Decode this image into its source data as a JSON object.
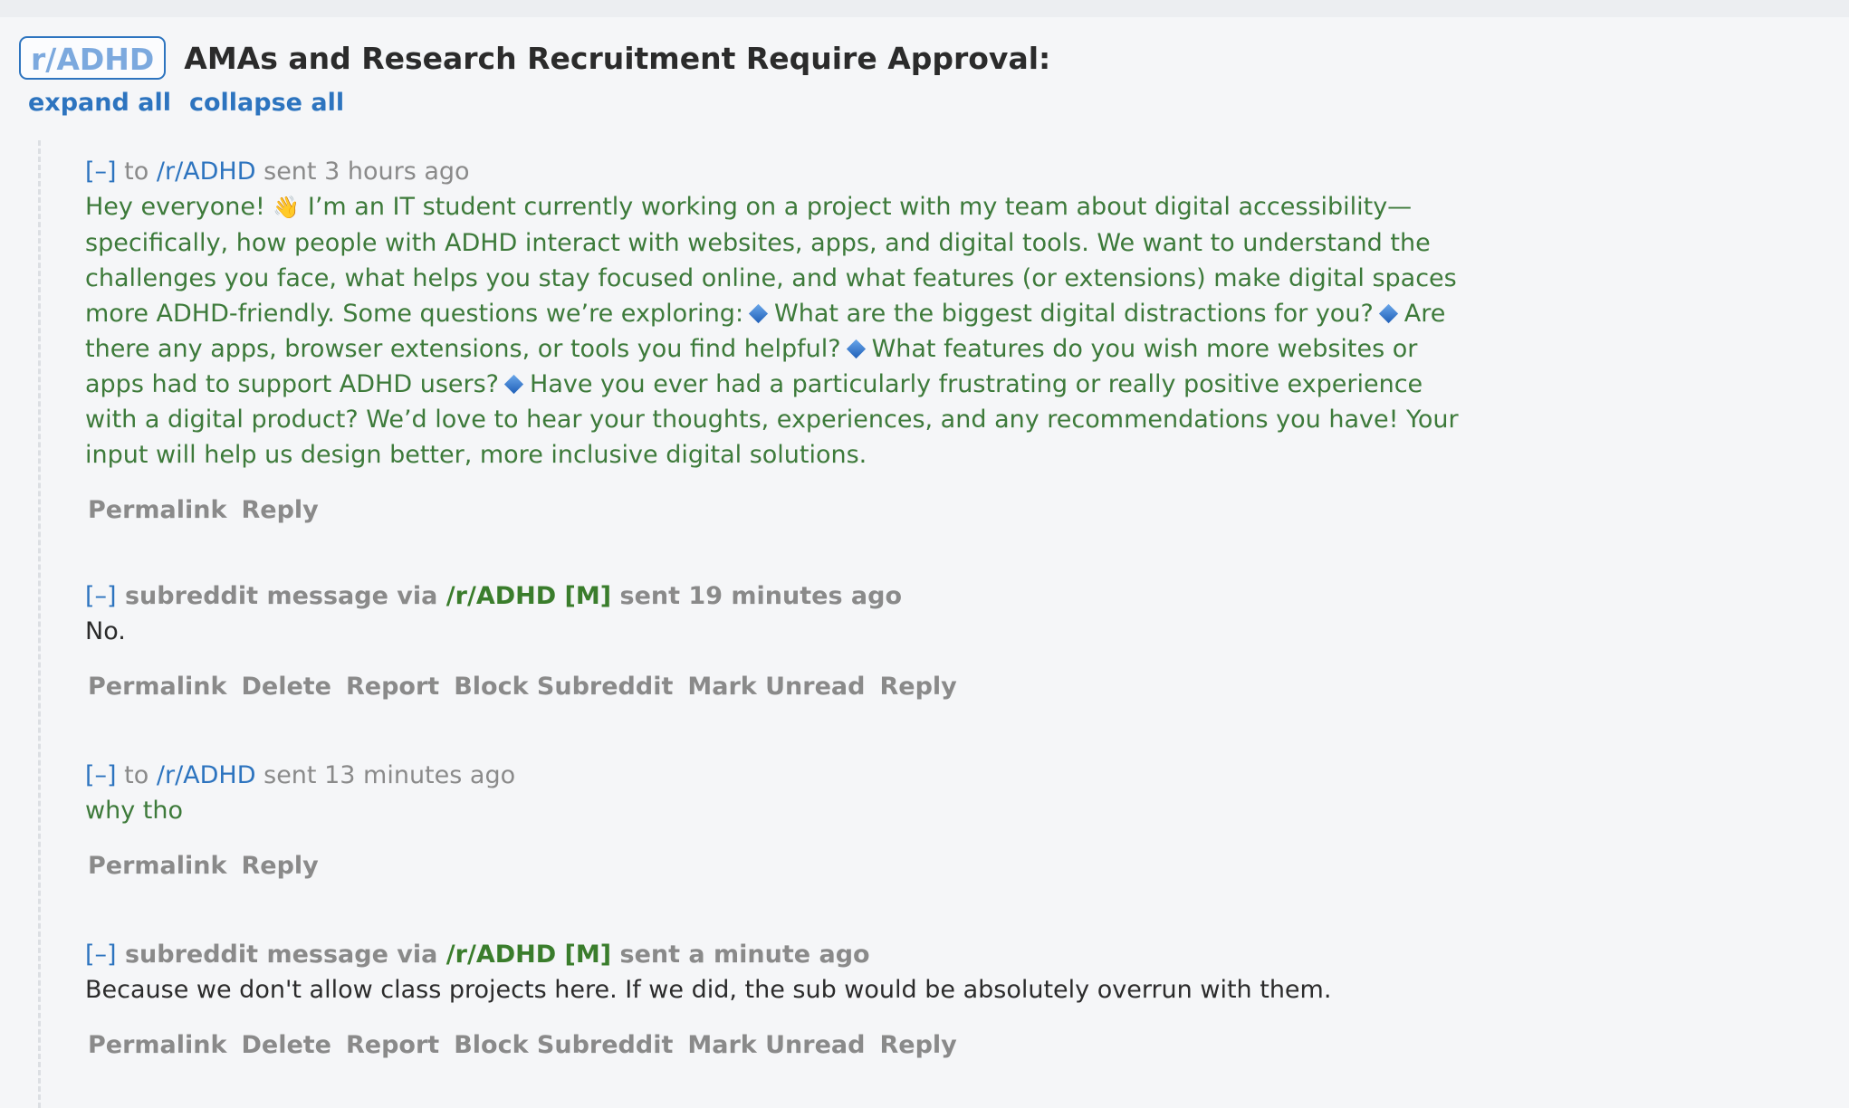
{
  "header": {
    "subreddit_badge": "r/ADHD",
    "title": "AMAs and Research Recruitment Require Approval:",
    "expand_all": "expand all",
    "collapse_all": "collapse all"
  },
  "messages": [
    {
      "toggle": "[–]",
      "prefix": "to",
      "target": "/r/ADHD",
      "sent": "sent 3 hours ago",
      "body_segments": [
        "Hey everyone! ",
        " I’m an IT student currently working on a project with my team about digital accessibility—specifically, how people with ADHD interact with websites, apps, and digital tools. We want to understand the challenges you face, what helps you stay focused online, and what features (or extensions) make digital spaces more ADHD-friendly. Some questions we’re exploring:",
        "What are the biggest digital distractions for you?",
        "Are there any apps, browser extensions, or tools you find helpful?",
        "What features do you wish more websites or apps had to support ADHD users?",
        "Have you ever had a particularly frustrating or really positive experience with a digital product? We’d love to hear your thoughts, experiences, and any recommendations you have! Your input will help us design better, more inclusive digital solutions."
      ],
      "wave_emoji": "👋",
      "actions": [
        "Permalink",
        "Reply"
      ]
    },
    {
      "toggle": "[–]",
      "prefix": "subreddit message via",
      "target": "/r/ADHD",
      "mod_tag": "[M]",
      "sent": "sent 19 minutes ago",
      "body": "No.",
      "actions": [
        "Permalink",
        "Delete",
        "Report",
        "Block Subreddit",
        "Mark Unread",
        "Reply"
      ]
    },
    {
      "toggle": "[–]",
      "prefix": "to",
      "target": "/r/ADHD",
      "sent": "sent 13 minutes ago",
      "body": "why tho",
      "actions": [
        "Permalink",
        "Reply"
      ]
    },
    {
      "toggle": "[–]",
      "prefix": "subreddit message via",
      "target": "/r/ADHD",
      "mod_tag": "[M]",
      "sent": "sent a minute ago",
      "body": "Because we don't allow class projects here. If we did, the sub would be absolutely overrun with them.",
      "actions": [
        "Permalink",
        "Delete",
        "Report",
        "Block Subreddit",
        "Mark Unread",
        "Reply"
      ]
    }
  ],
  "colors": {
    "link_blue": "#2d74bf",
    "mod_green": "#3a7d2c",
    "sent_body_green": "#3d7a3a",
    "meta_gray": "#8a8a8a"
  },
  "icons": [
    "wave-emoji-icon",
    "blue-diamond-icon"
  ]
}
